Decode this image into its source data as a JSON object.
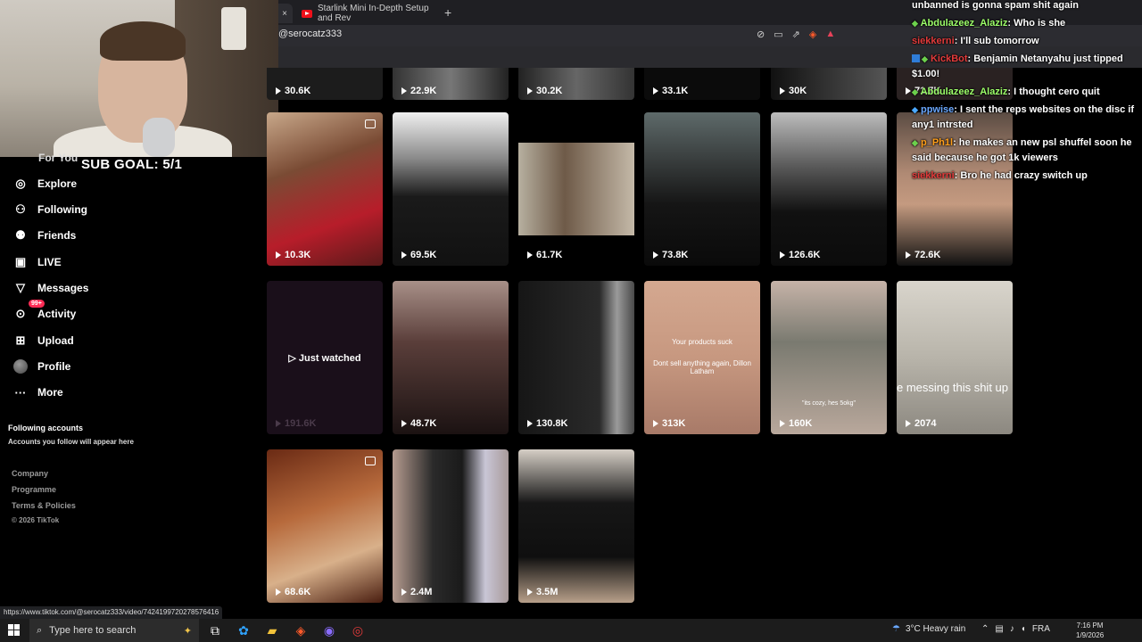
{
  "browser": {
    "active_tab_close": "×",
    "other_tab_title": "Starlink Mini In-Depth Setup and Rev",
    "new_tab": "+",
    "url": "@serocatz333"
  },
  "overlay": {
    "sub_goal": "SUB GOAL: 5/1"
  },
  "sidebar": {
    "partial_item": "For You",
    "items": [
      {
        "label": "Explore",
        "icon": "compass-icon"
      },
      {
        "label": "Following",
        "icon": "user-icon"
      },
      {
        "label": "Friends",
        "icon": "users-icon"
      },
      {
        "label": "LIVE",
        "icon": "live-tv-icon"
      },
      {
        "label": "Messages",
        "icon": "paper-plane-icon"
      },
      {
        "label": "Activity",
        "icon": "activity-icon",
        "badge": "99+"
      },
      {
        "label": "Upload",
        "icon": "plus-square-icon"
      },
      {
        "label": "Profile",
        "icon": "avatar"
      },
      {
        "label": "More",
        "icon": "more-icon"
      }
    ],
    "following_heading": "Following accounts",
    "following_sub": "Accounts you follow will appear here",
    "footer": [
      "Company",
      "Programme",
      "Terms & Policies"
    ],
    "copyright": "© 2026 TikTok"
  },
  "grid": {
    "top_row": [
      "30.6K",
      "22.9K",
      "30.2K",
      "33.1K",
      "30K",
      "71.7K"
    ],
    "row1": [
      "10.3K",
      "69.5K",
      "61.7K",
      "73.8K",
      "126.6K",
      "72.6K"
    ],
    "row2": [
      "191.6K",
      "48.7K",
      "130.8K",
      "313K",
      "160K",
      "2074"
    ],
    "row3": [
      "68.6K",
      "2.4M",
      "3.5M"
    ],
    "just_watched": "Just watched",
    "overlay_product_1": "Your products suck",
    "overlay_product_2": "Dont sell anything again, Dillon Latham",
    "overlay_cozy": "\"its cozy, hes 5okg\"",
    "overlay_messing": "e messing this shit up"
  },
  "chat": [
    {
      "user": "",
      "text": "unbanned is gonna spam shit again"
    },
    {
      "user": "Abdulazeez_Alaziz",
      "text": ": Who is she",
      "color": "#9dff6a"
    },
    {
      "user": "siekkerni",
      "text": ": I'll sub tomorrow",
      "color": "#e33b3b"
    },
    {
      "user": "KickBot",
      "text": ": Benjamin Netanyahu just tipped $1.00!",
      "color": "#e33b3b"
    },
    {
      "user": "Abdulazeez_Alaziz",
      "text": ": I thought cero quit",
      "color": "#9dff6a"
    },
    {
      "user": "ppwise",
      "text": ": I sent the reps websites on the disc if any1 intrsted",
      "color": "#6aa8ff"
    },
    {
      "user": "p_Ph1l",
      "text": ": he makes an new psl shuffel soon he said because he got 1k viewers",
      "color": "#ff9f1a"
    },
    {
      "user": "siekkerni",
      "text": ": Bro he had crazy switch up",
      "color": "#e33b3b"
    }
  ],
  "status_url": "https://www.tiktok.com/@serocatz333/video/7424199720278576416",
  "taskbar": {
    "search_placeholder": "Type here to search",
    "weather": "3°C  Heavy rain",
    "lang": "FRA",
    "time": "7:16 PM",
    "date": "1/9/2026"
  }
}
